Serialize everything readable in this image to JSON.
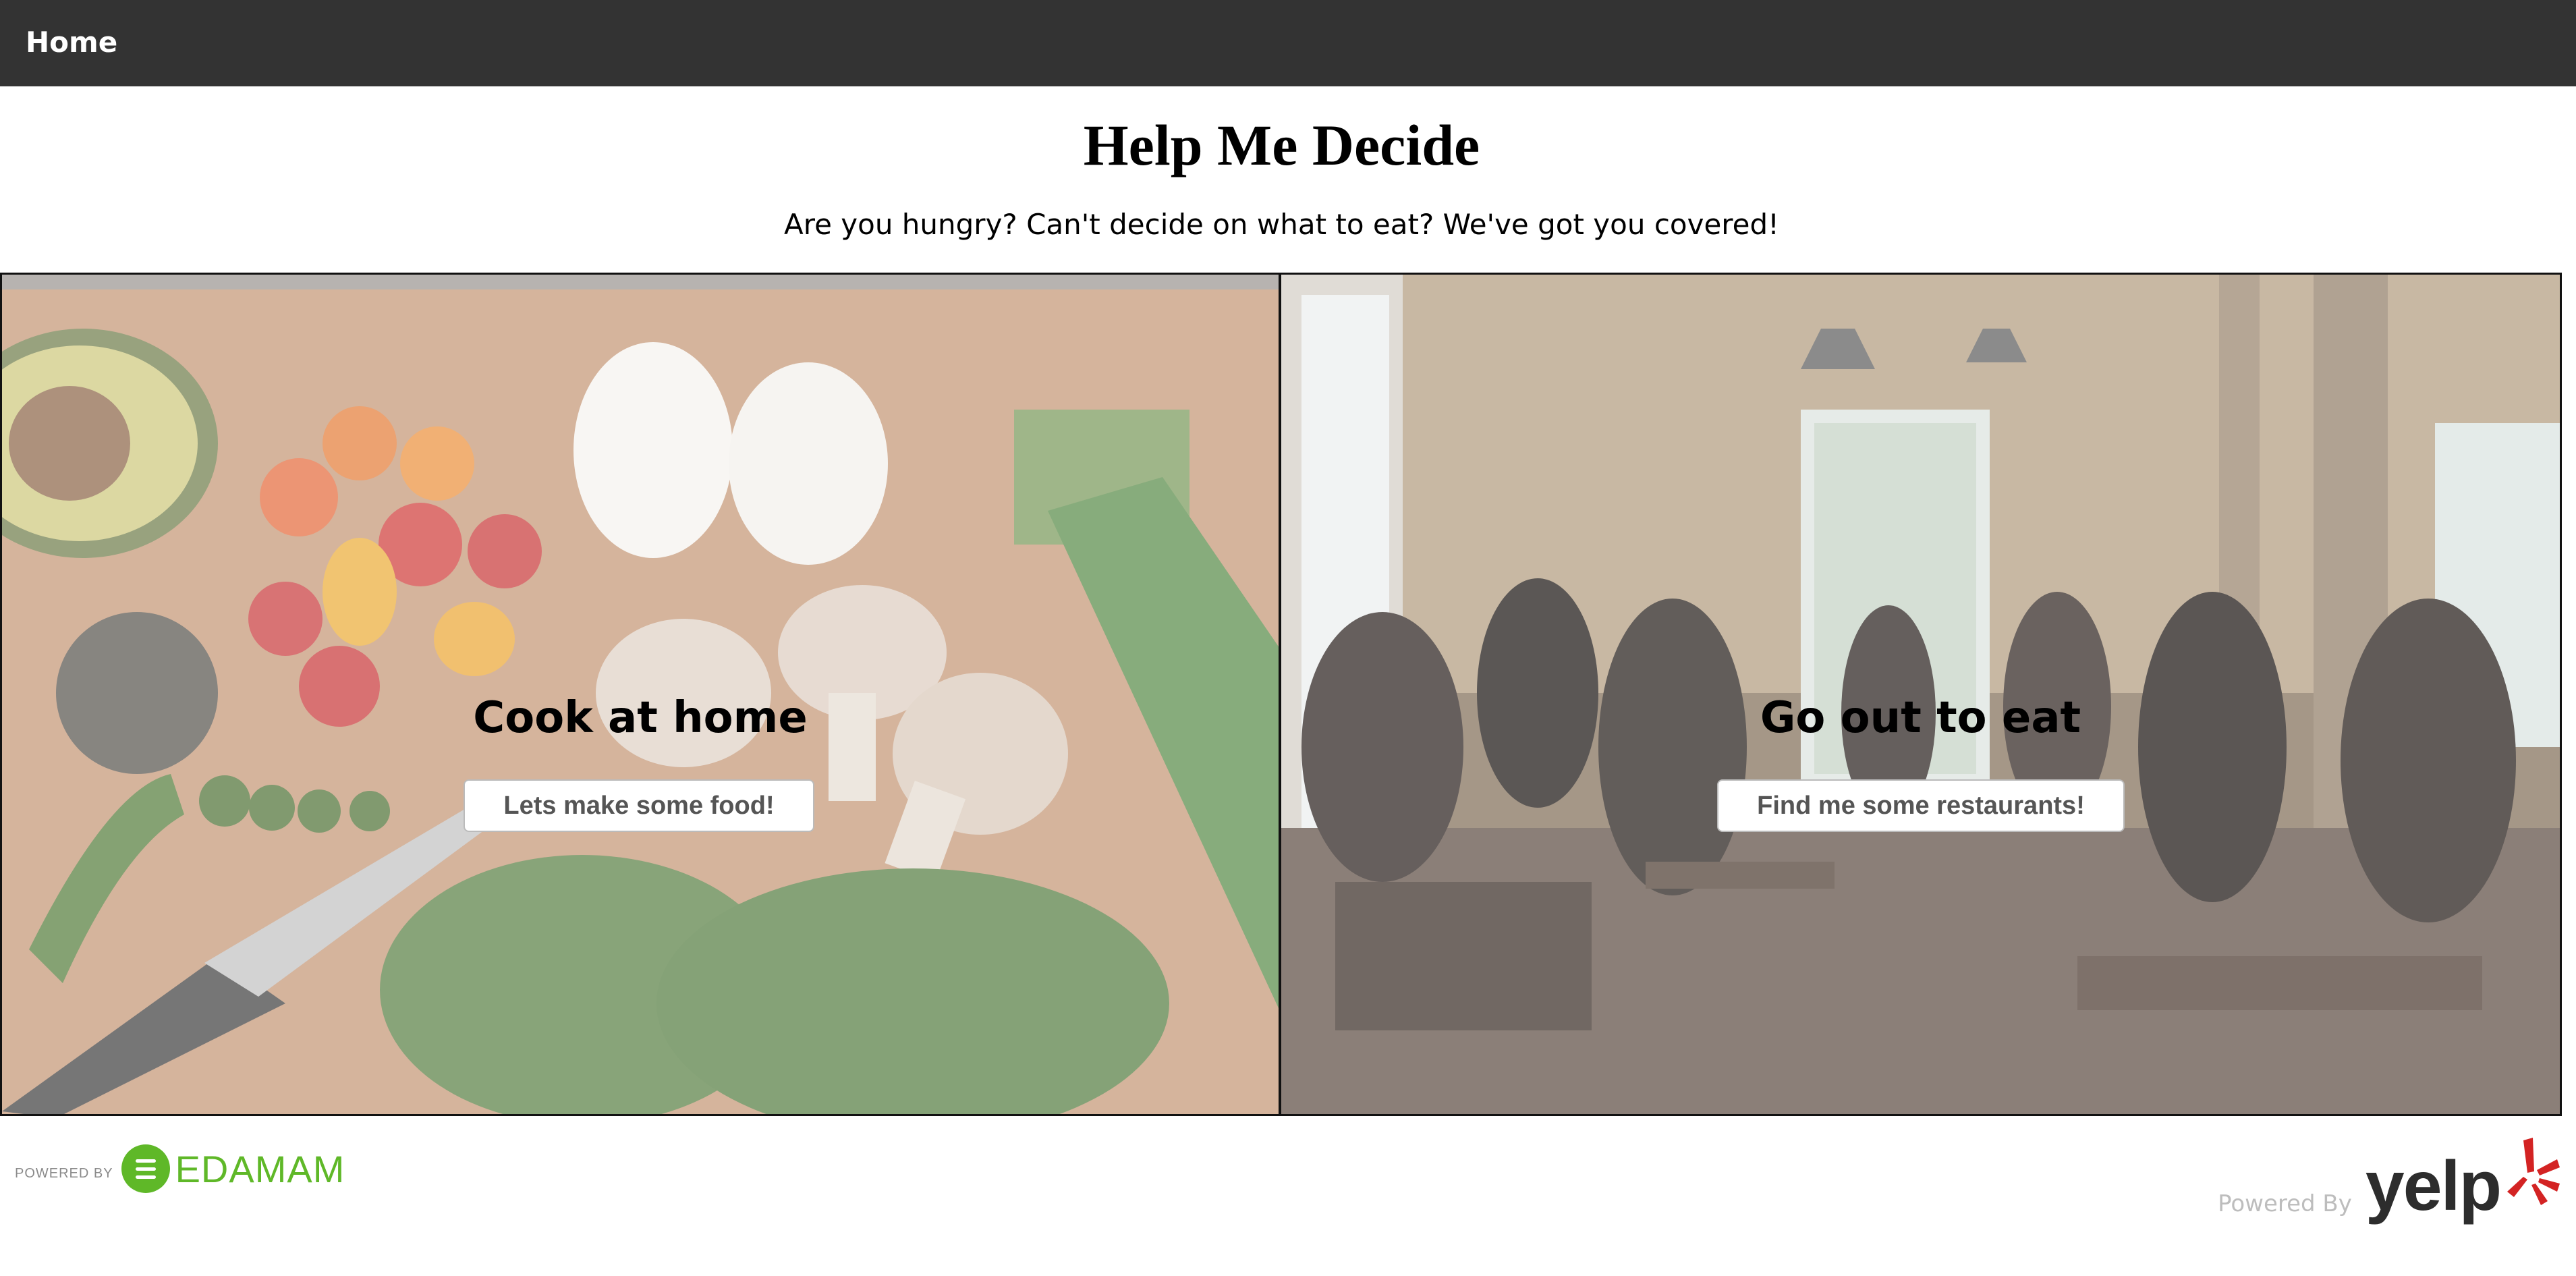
{
  "nav": {
    "home_label": "Home"
  },
  "header": {
    "title": "Help Me Decide",
    "subtitle": "Are you hungry? Can't decide on what to eat? We've got you covered!"
  },
  "panels": [
    {
      "heading": "Cook at home",
      "button_label": "Lets make some food!"
    },
    {
      "heading": "Go out to eat",
      "button_label": "Find me some restaurants!"
    }
  ],
  "footer": {
    "edamam": {
      "powered_by": "POWERED BY",
      "brand": "EDAMAM"
    },
    "yelp": {
      "powered_by": "Powered By",
      "brand": "yelp"
    }
  },
  "colors": {
    "navbar": "#333333",
    "edamam_green": "#5fb828",
    "yelp_red": "#d32323"
  }
}
